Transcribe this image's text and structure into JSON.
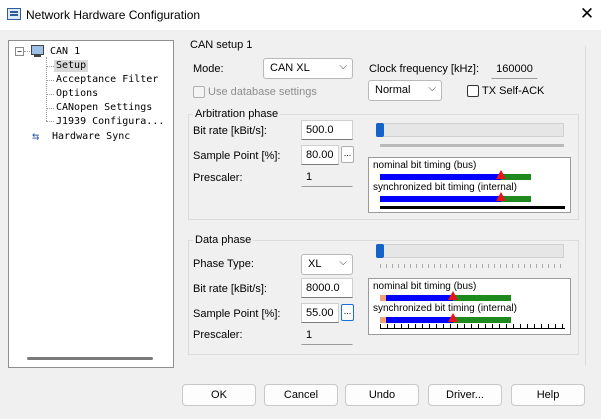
{
  "window": {
    "title": "Network Hardware Configuration",
    "close_glyph": "✕"
  },
  "tree": {
    "root": "CAN 1",
    "children": [
      "Setup",
      "Acceptance Filter",
      "Options",
      "CANopen Settings",
      "J1939 Configura..."
    ],
    "sibling": "Hardware Sync",
    "selected": "Setup"
  },
  "can_setup": {
    "title": "CAN setup 1",
    "mode_label": "Mode:",
    "mode_value": "CAN XL",
    "clock_label": "Clock frequency [kHz]:",
    "clock_value": "160000",
    "use_db_label": "Use database settings",
    "normal_value": "Normal",
    "tx_self_ack_label": "TX Self-ACK"
  },
  "arbitration": {
    "title": "Arbitration phase",
    "bitrate_label": "Bit rate [kBit/s]:",
    "bitrate_value": "500.0",
    "sample_label": "Sample Point [%]:",
    "sample_value": "80.00",
    "prescaler_label": "Prescaler:",
    "prescaler_value": "1",
    "dots": "...",
    "slider_level": 0.0,
    "nominal_label": "nominal bit timing (bus)",
    "sync_label": "synchronized bit timing (internal)"
  },
  "data_phase": {
    "title": "Data phase",
    "phase_type_label": "Phase Type:",
    "phase_type_value": "XL",
    "bitrate_label": "Bit rate [kBit/s]:",
    "bitrate_value": "8000.0",
    "sample_label": "Sample Point [%]:",
    "sample_value": "55.00",
    "prescaler_label": "Prescaler:",
    "prescaler_value": "1",
    "dots": "...",
    "slider_level": 0.0,
    "nominal_label": "nominal bit timing (bus)",
    "sync_label": "synchronized bit timing (internal)"
  },
  "buttons": {
    "ok": "OK",
    "cancel": "Cancel",
    "undo": "Undo",
    "driver": "Driver...",
    "help": "Help"
  },
  "colors": {
    "accent": "#1463c9",
    "timing_blue": "#0000ff",
    "timing_green": "#1e8a1e",
    "timing_salmon": "#f4a07a",
    "marker_red": "#e8141b"
  },
  "icons": {
    "app": "network-icon",
    "root": "computer-icon",
    "sync": "sync-icon",
    "chevron": "chevron-down-icon"
  }
}
